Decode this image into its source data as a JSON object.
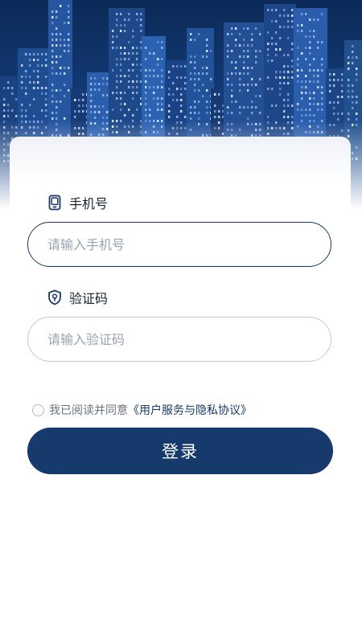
{
  "phone": {
    "label": "手机号",
    "placeholder": "请输入手机号",
    "value": ""
  },
  "code": {
    "label": "验证码",
    "placeholder": "请输入验证码",
    "value": ""
  },
  "agreement": {
    "checked": false,
    "prefix": "我已阅读并同意",
    "link": "《用户服务与隐私协议》"
  },
  "login": {
    "label": "登录"
  },
  "colors": {
    "brand": "#153a6b",
    "placeholder": "#9aa3b0",
    "inactive_border": "#c4cad4"
  },
  "icons": {
    "phone_field": "phone-icon",
    "code_field": "shield-icon"
  }
}
